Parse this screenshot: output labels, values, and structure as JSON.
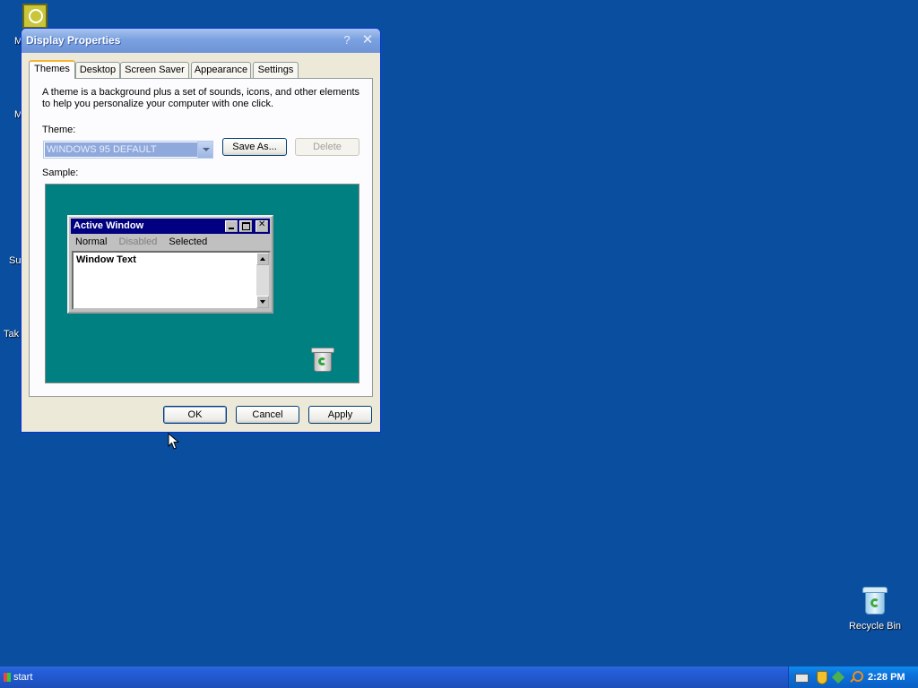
{
  "desktop": {
    "labels": [
      "M",
      "M",
      "Su",
      "Tak"
    ],
    "recycle_bin_label": "Recycle Bin"
  },
  "dialog": {
    "title": "Display Properties",
    "help_glyph": "?",
    "close_glyph": "✕",
    "tabs": [
      {
        "label": "Themes",
        "active": true
      },
      {
        "label": "Desktop",
        "active": false
      },
      {
        "label": "Screen Saver",
        "active": false
      },
      {
        "label": "Appearance",
        "active": false
      },
      {
        "label": "Settings",
        "active": false
      }
    ],
    "description": "A theme is a background plus a set of sounds, icons, and other elements to help you personalize your computer with one click.",
    "theme_label": "Theme:",
    "theme_value": "WINDOWS 95 DEFAULT",
    "save_as_label": "Save As...",
    "delete_label": "Delete",
    "sample_label": "Sample:",
    "sample": {
      "window_title": "Active Window",
      "menu": {
        "normal": "Normal",
        "disabled": "Disabled",
        "selected": "Selected"
      },
      "window_text": "Window Text",
      "background_color": "#008080",
      "titlebar_color": "#000080"
    },
    "ok_label": "OK",
    "cancel_label": "Cancel",
    "apply_label": "Apply"
  },
  "taskbar": {
    "start_label": "start",
    "clock": "2:28 PM",
    "tray_icons": [
      "keyboard-icon",
      "security-shield-icon",
      "network-icon",
      "search-icon"
    ]
  }
}
